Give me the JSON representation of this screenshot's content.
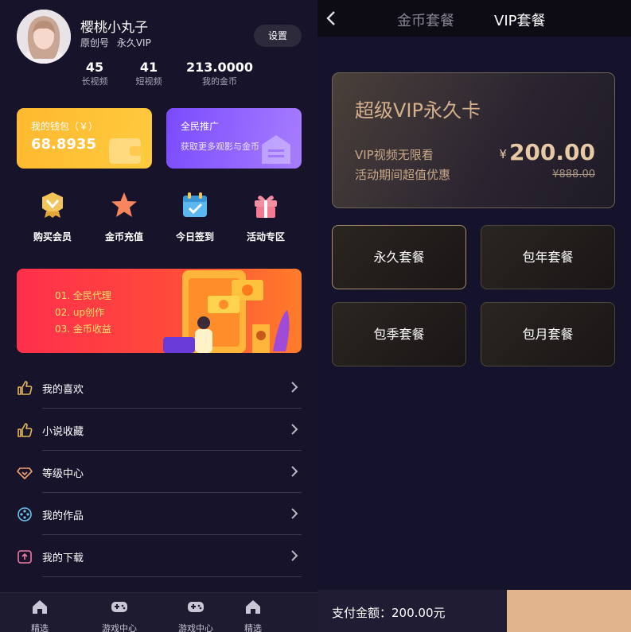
{
  "profile": {
    "username": "樱桃小丸子",
    "tag_original": "原创号",
    "tag_vip": "永久VIP",
    "settings_label": "设置"
  },
  "stats": [
    {
      "value": "45",
      "label": "长视频"
    },
    {
      "value": "41",
      "label": "短视频"
    },
    {
      "value": "213.0000",
      "label": "我的金币"
    }
  ],
  "wallet": {
    "title": "我的钱包（￥）",
    "value": "68.8935"
  },
  "promo": {
    "title": "全民推广",
    "subtitle": "获取更多观影与金币"
  },
  "quick_actions": [
    {
      "label": "购买会员",
      "icon": "medal-icon"
    },
    {
      "label": "金币充值",
      "icon": "star-icon"
    },
    {
      "label": "今日签到",
      "icon": "calendar-check-icon"
    },
    {
      "label": "活动专区",
      "icon": "gift-icon"
    }
  ],
  "banner": {
    "lines": [
      "01. 全民代理",
      "02. up创作",
      "03. 金币收益"
    ]
  },
  "menu": [
    {
      "label": "我的喜欢",
      "icon": "thumbs-up-icon"
    },
    {
      "label": "小说收藏",
      "icon": "thumbs-up-icon"
    },
    {
      "label": "等级中心",
      "icon": "diamond-icon"
    },
    {
      "label": "我的作品",
      "icon": "film-reel-icon"
    },
    {
      "label": "我的下载",
      "icon": "download-icon"
    }
  ],
  "tabbar": [
    {
      "label": "精选",
      "icon": "home-icon"
    },
    {
      "label": "游戏中心",
      "icon": "gamepad-icon"
    },
    {
      "label": "游戏中心",
      "icon": "gamepad-icon"
    },
    {
      "label": "精选",
      "icon": "home-icon"
    }
  ],
  "vip_page": {
    "tabs": [
      "金币套餐",
      "VIP套餐"
    ],
    "active_tab": "VIP套餐",
    "card": {
      "title": "超级VIP永久卡",
      "line1": "VIP视频无限看",
      "line2": "活动期间超值优惠",
      "currency": "¥",
      "price": "200.00",
      "old_price": "¥888.00"
    },
    "packages": [
      "永久套餐",
      "包年套餐",
      "包季套餐",
      "包月套餐"
    ],
    "selected_package": "永久套餐",
    "pay_text": "支付金额：200.00元"
  },
  "colors": {
    "wallet": "#ffb92f",
    "promo": "#8a5cff",
    "banner": "#ff2f4b",
    "gold": "#d4b08c",
    "pay_button": "#e2b48e"
  }
}
